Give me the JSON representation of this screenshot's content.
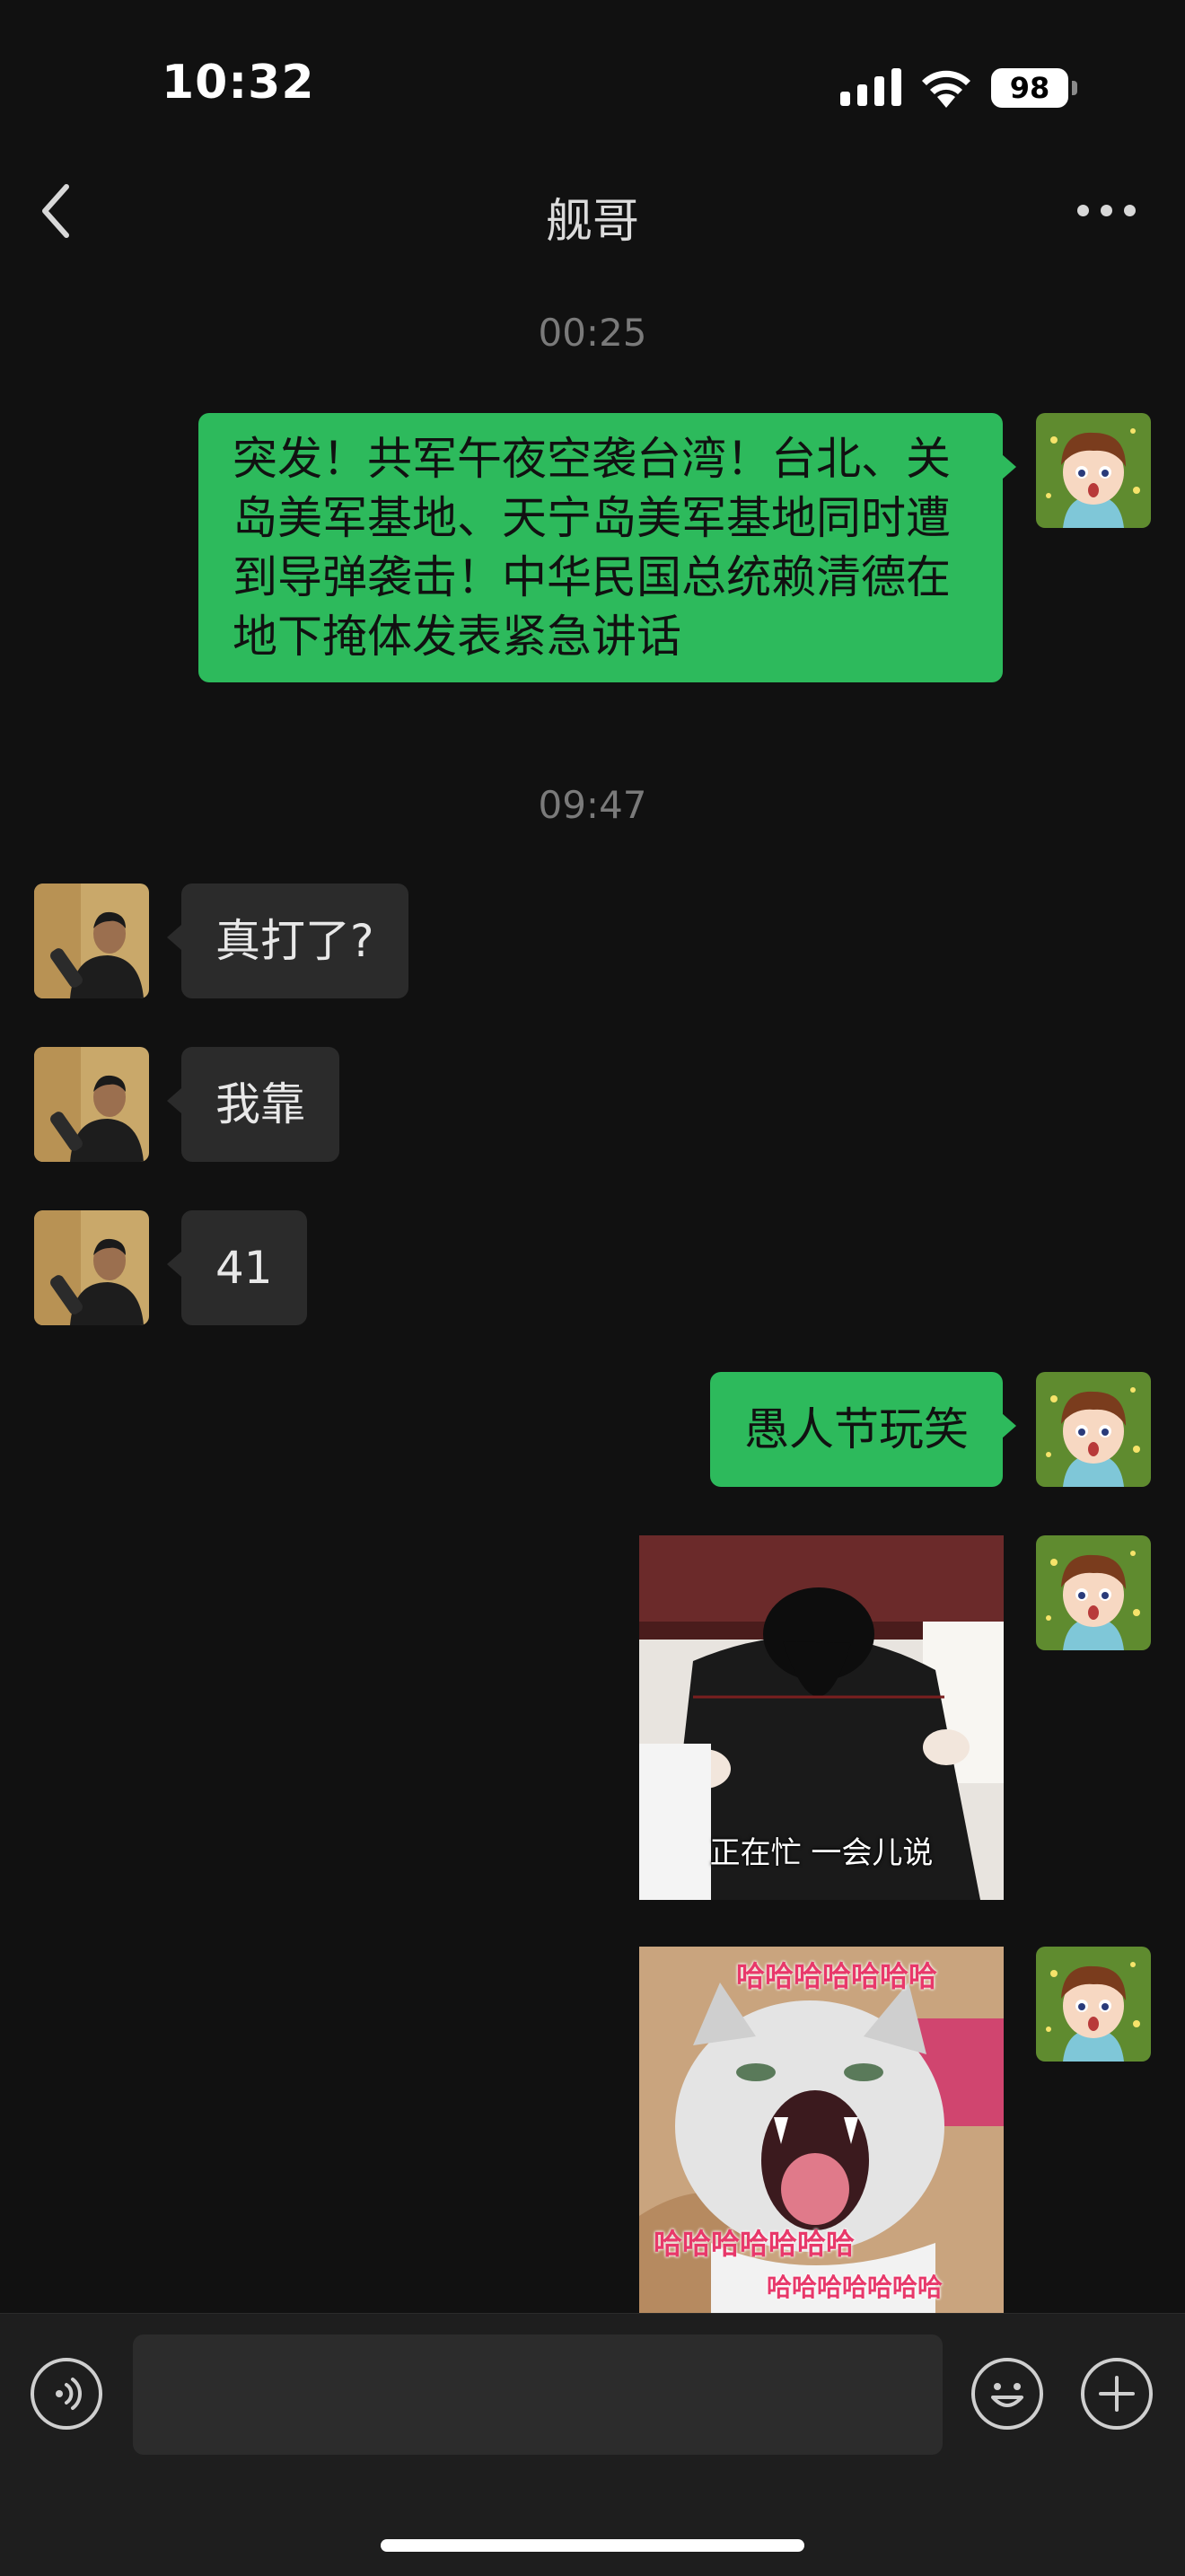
{
  "status_bar": {
    "time": "10:32",
    "battery": "98"
  },
  "nav": {
    "title": "舰哥"
  },
  "timestamps": {
    "t1": "00:25",
    "t2": "09:47"
  },
  "messages": {
    "m1": "突发！共军午夜空袭台湾！台北、关岛美军基地、天宁岛美军基地同时遭到导弹袭击！中华民国总统赖清德在地下掩体发表紧急讲话",
    "m2": "真打了?",
    "m3": "我靠",
    "m4": "41",
    "m5": "愚人节玩笑"
  },
  "stickers": {
    "s1_caption": "正在忙 一会儿说",
    "s2_top": "哈哈哈哈哈哈哈",
    "s2_mid": "哈哈哈哈哈哈哈",
    "s2_bottom": "哈哈哈哈哈哈哈"
  },
  "icons": {
    "back": "chevron-left-icon",
    "more": "more-dots-icon",
    "voice": "voice-icon",
    "emoji": "emoji-icon",
    "add": "plus-icon"
  },
  "colors": {
    "background": "#111111",
    "my_bubble": "#2dba5c",
    "other_bubble": "#2b2b2b"
  }
}
